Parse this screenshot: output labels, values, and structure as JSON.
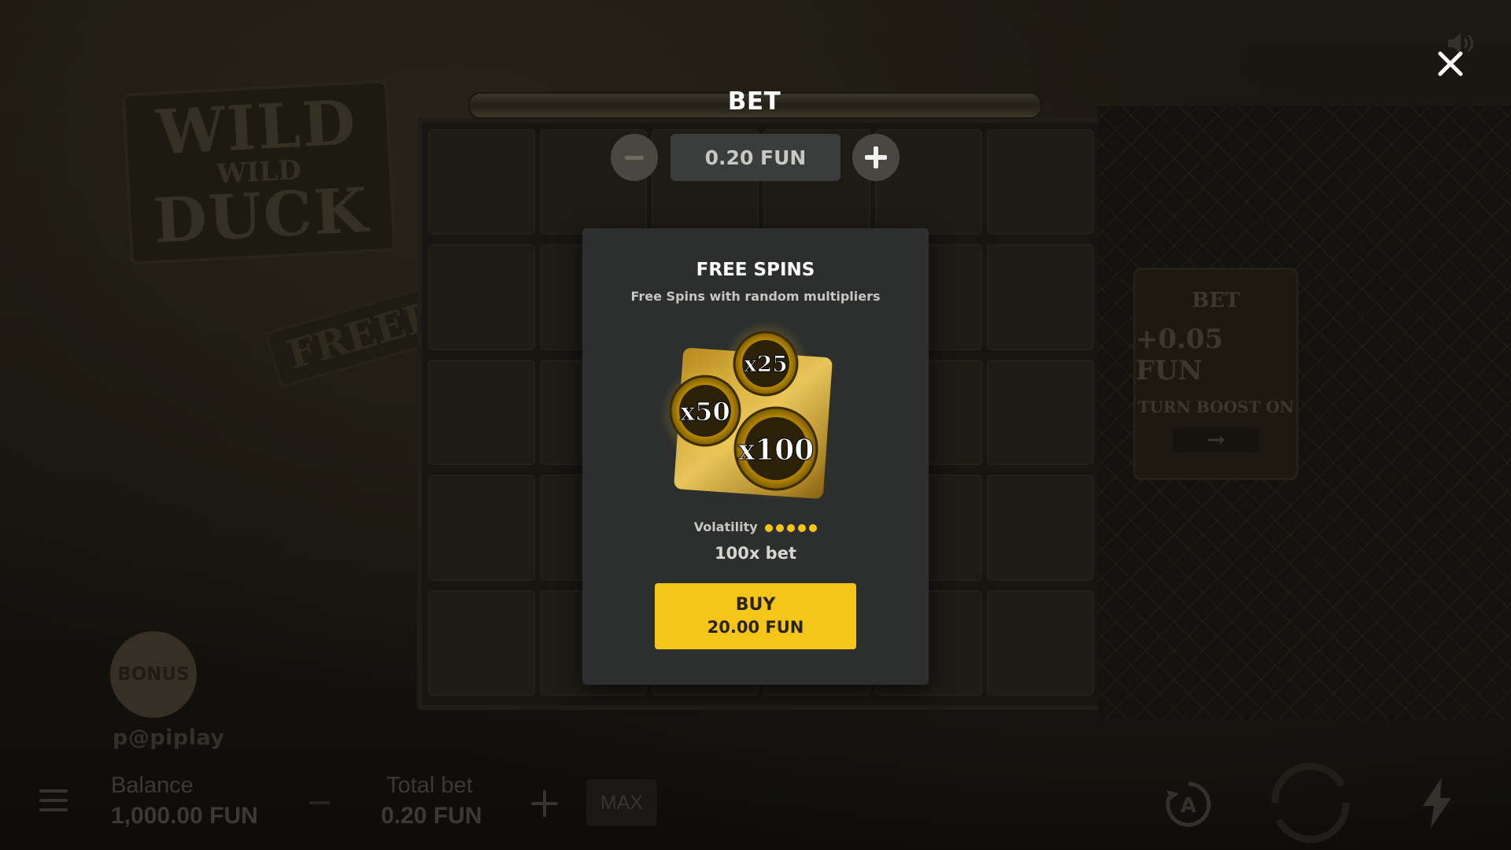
{
  "game": {
    "logo": {
      "line1": "WILD",
      "line2": "WILD",
      "line3": "DUCK"
    },
    "sign_freedom": "FREEDOM",
    "side_sign": {
      "line1": "BET",
      "line2": "+0.05 FUN",
      "line3": "TURN BOOST ON",
      "arrow": "→"
    },
    "bonus_label": "BONUS",
    "brand": "p@piplay"
  },
  "bottom_bar": {
    "balance_label": "Balance",
    "balance_value": "1,000.00 FUN",
    "total_bet_label": "Total bet",
    "total_bet_value": "0.20 FUN",
    "max_label": "MAX",
    "autoplay_letter": "A"
  },
  "bet_panel": {
    "title": "BET",
    "value": "0.20 FUN"
  },
  "free_spins": {
    "title": "FREE SPINS",
    "subtitle": "Free Spins with random multipliers",
    "coins": [
      "x25",
      "x50",
      "x100"
    ],
    "volatility_label": "Volatility",
    "volatility_level": 5,
    "volatility_max": 5,
    "multiplier": "100x bet",
    "buy_label": "BUY",
    "buy_price": "20.00 FUN"
  },
  "colors": {
    "accent_yellow": "#f5c518",
    "modal_bg": "#2d2f2e"
  },
  "icons": [
    "sound-icon",
    "close-icon",
    "menu-icon",
    "autoplay-icon",
    "spin-icon",
    "turbo-icon"
  ]
}
